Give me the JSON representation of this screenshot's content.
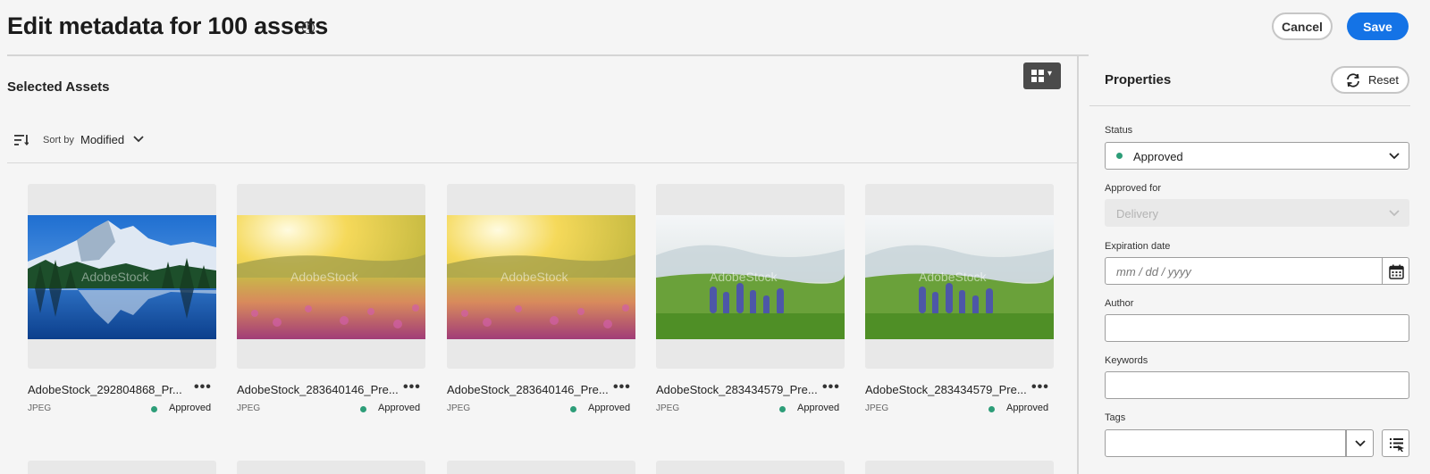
{
  "header": {
    "title": "Edit metadata for 100 assets",
    "info_icon": "info-icon",
    "cancel_label": "Cancel",
    "save_label": "Save"
  },
  "assets": {
    "section_title": "Selected Assets",
    "view_switcher_icon": "grid-view-icon",
    "sort_label": "Sort by",
    "sort_value": "Modified",
    "items": [
      {
        "name": "AdobeStock_292804868_Pr...",
        "type": "JPEG",
        "status": "Approved",
        "thumb": "mountain-lake"
      },
      {
        "name": "AdobeStock_283640146_Pre...",
        "type": "JPEG",
        "status": "Approved",
        "thumb": "sunset-meadow"
      },
      {
        "name": "AdobeStock_283640146_Pre...",
        "type": "JPEG",
        "status": "Approved",
        "thumb": "sunset-meadow"
      },
      {
        "name": "AdobeStock_283434579_Pre...",
        "type": "JPEG",
        "status": "Approved",
        "thumb": "lupine-field"
      },
      {
        "name": "AdobeStock_283434579_Pre...",
        "type": "JPEG",
        "status": "Approved",
        "thumb": "lupine-field"
      }
    ]
  },
  "properties": {
    "title": "Properties",
    "reset_label": "Reset",
    "status_label": "Status",
    "status_value": "Approved",
    "approved_for_label": "Approved for",
    "approved_for_value": "Delivery",
    "expiration_label": "Expiration date",
    "expiration_placeholder": "mm / dd / yyyy",
    "author_label": "Author",
    "keywords_label": "Keywords",
    "tags_label": "Tags"
  },
  "colors": {
    "accent": "#1473e6",
    "approved": "#2d9d78"
  }
}
